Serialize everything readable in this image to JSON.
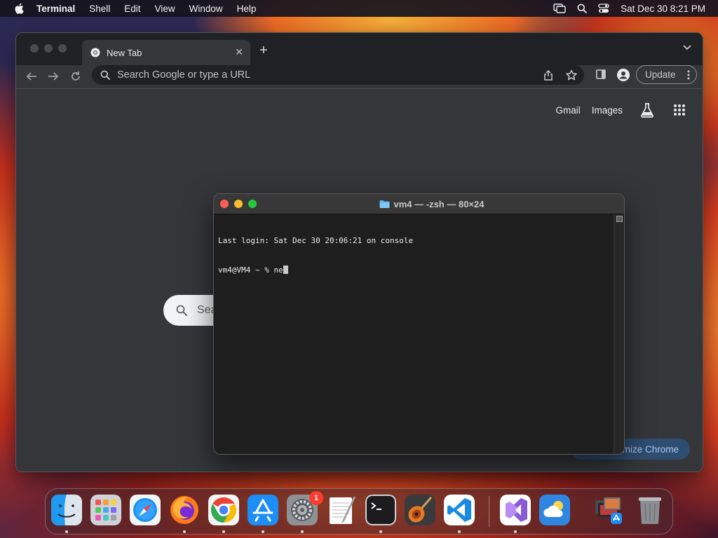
{
  "menubar": {
    "app_name": "Terminal",
    "items": [
      "Shell",
      "Edit",
      "View",
      "Window",
      "Help"
    ],
    "datetime": "Sat Dec 30  8:21 PM"
  },
  "chrome": {
    "tab_title": "New Tab",
    "omnibox_placeholder": "Search Google or type a URL",
    "update_label": "Update",
    "ntp_links": {
      "gmail": "Gmail",
      "images": "Images"
    },
    "ntp_search_placeholder": "Sea",
    "customize_label": "mize Chrome"
  },
  "terminal": {
    "title": "vm4 — -zsh — 80×24",
    "lines": [
      "Last login: Sat Dec 30 20:06:21 on console",
      "vm4@VM4 ~ % ne"
    ]
  },
  "dock": {
    "apps": [
      "Finder",
      "Launchpad",
      "Safari",
      "Firefox",
      "Google Chrome",
      "App Store",
      "System Settings",
      "TextEdit",
      "Terminal",
      "GarageBand",
      "Visual Studio Code",
      "Visual Studio",
      "Weather",
      "Downloads",
      "Trash"
    ],
    "system_settings_badge": "1"
  },
  "colors": {
    "chrome_bg": "#35363a",
    "terminal_bg": "#1e1e1e",
    "close_red": "#fe5f57",
    "minimize_yellow": "#febc2e",
    "zoom_green": "#28c840"
  }
}
